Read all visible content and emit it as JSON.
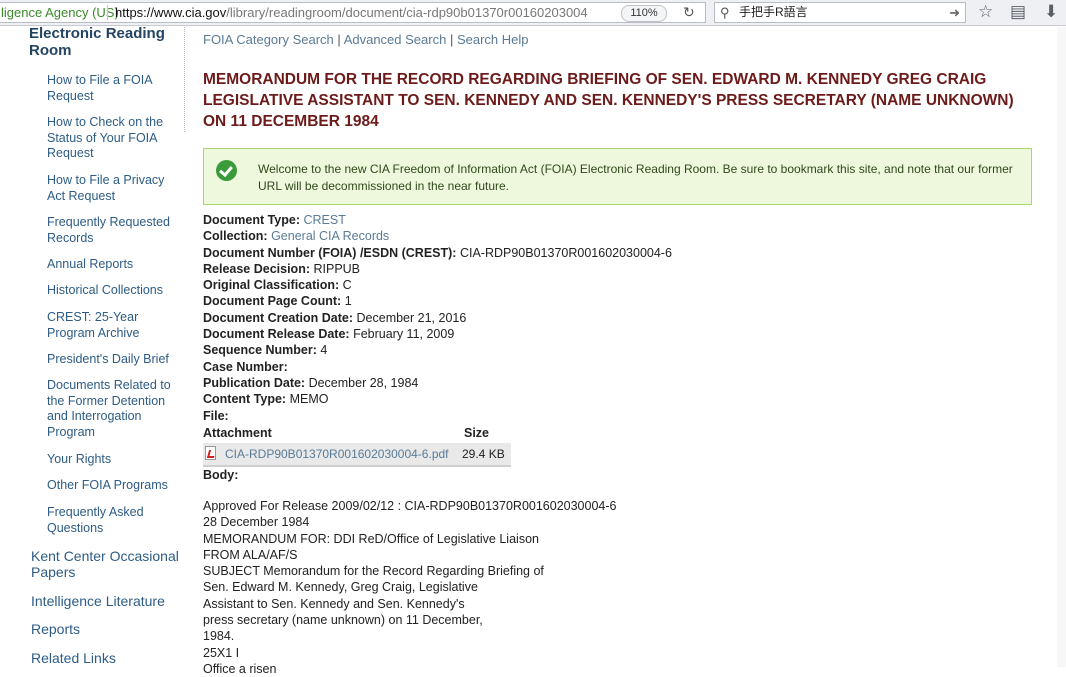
{
  "browser": {
    "identity": "ligence Agency (US)",
    "url_host": "https://www.cia.gov",
    "url_path": "/library/readingroom/document/cia-rdp90b01370r00160203004",
    "zoom": "110%",
    "search_query": "手把手R語言"
  },
  "sidebar": {
    "section_title": "Electronic Reading Room",
    "subitems": [
      "How to File a FOIA Request",
      "How to Check on the Status of Your FOIA Request",
      "How to File a Privacy Act Request",
      "Frequently Requested Records",
      "Annual Reports",
      "Historical Collections",
      "CREST: 25-Year Program Archive",
      "President's Daily Brief",
      "Documents Related to the Former Detention and Interrogation Program",
      "Your Rights",
      "Other FOIA Programs",
      "Frequently Asked Questions"
    ],
    "main_items": [
      "Kent Center Occasional Papers",
      "Intelligence Literature",
      "Reports",
      "Related Links"
    ]
  },
  "toplinks": [
    "FOIA Category Search",
    "Advanced Search",
    "Search Help"
  ],
  "title": "MEMORANDUM FOR THE RECORD REGARDING BRIEFING OF SEN. EDWARD M. KENNEDY GREG CRAIG LEGISLATIVE ASSISTANT TO SEN. KENNEDY AND SEN. KENNEDY'S PRESS SECRETARY (NAME UNKNOWN) ON 11 DECEMBER 1984",
  "notice": "Welcome to the new CIA Freedom of Information Act (FOIA) Electronic Reading Room.  Be sure to bookmark this site, and note that our former URL will be decommissioned in the near future.",
  "metadata": [
    {
      "label": "Document Type:",
      "value": "CREST",
      "link": true
    },
    {
      "label": "Collection:",
      "value": "General CIA Records",
      "link": true
    },
    {
      "label": "Document Number (FOIA) /ESDN (CREST):",
      "value": "CIA-RDP90B01370R001602030004-6",
      "link": false
    },
    {
      "label": "Release Decision:",
      "value": "RIPPUB",
      "link": false
    },
    {
      "label": "Original Classification:",
      "value": "C",
      "link": false
    },
    {
      "label": "Document Page Count:",
      "value": "1",
      "link": false
    },
    {
      "label": "Document Creation Date:",
      "value": "December 21, 2016",
      "link": false
    },
    {
      "label": "Document Release Date:",
      "value": "February 11, 2009",
      "link": false
    },
    {
      "label": "Sequence Number:",
      "value": "4",
      "link": false
    },
    {
      "label": "Case Number:",
      "value": "",
      "link": false
    },
    {
      "label": "Publication Date:",
      "value": "December 28, 1984",
      "link": false
    },
    {
      "label": "Content Type:",
      "value": "MEMO",
      "link": false
    },
    {
      "label": "File:",
      "value": "",
      "link": false
    }
  ],
  "attachment": {
    "col_attachment": "Attachment",
    "col_size": "Size",
    "filename": "CIA-RDP90B01370R001602030004-6.pdf",
    "size": "29.4 KB"
  },
  "body_label": "Body:",
  "body_lines": [
    "Approved For Release 2009/02/12 : CIA-RDP90B01370R001602030004-6",
    "28 December 1984",
    "MEMORANDUM FOR: DDI ReD/Office of Legislative Liaison",
    "FROM ALA/AF/S",
    "SUBJECT Memorandum for the Record Regarding Briefing of",
    "Sen. Edward M. Kennedy, Greg Craig, Legislative",
    "Assistant to Sen. Kennedy and Sen. Kennedy's",
    "press secretary (name unknown) on 11 December,",
    "1984.",
    "25X1 I",
    "Office a risen"
  ]
}
